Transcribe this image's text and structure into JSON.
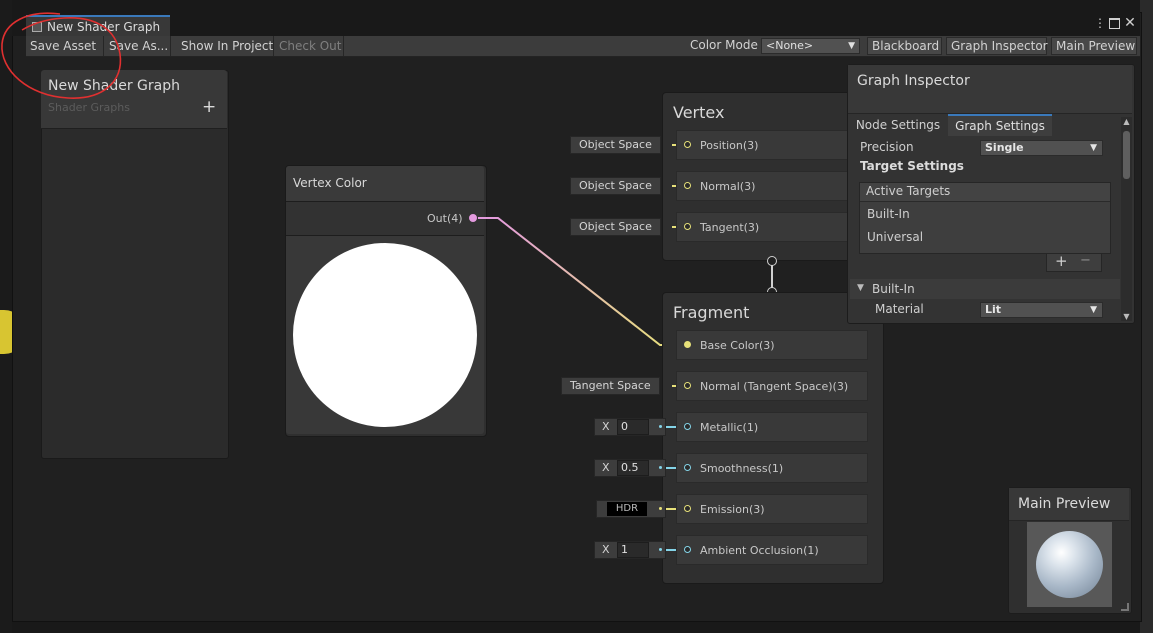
{
  "tab": {
    "title": "New Shader Graph"
  },
  "toolbar": {
    "save_asset": "Save Asset",
    "save_as": "Save As...",
    "show_in_project": "Show In Project",
    "check_out": "Check Out",
    "color_mode_label": "Color Mode",
    "color_mode_value": "<None>",
    "blackboard": "Blackboard",
    "graph_inspector": "Graph Inspector",
    "main_preview": "Main Preview"
  },
  "blackboard": {
    "title": "New Shader Graph",
    "subtitle": "Shader Graphs",
    "add": "+"
  },
  "vertex_color_node": {
    "title": "Vertex Color",
    "output": "Out(4)"
  },
  "vertex_block": {
    "title": "Vertex",
    "ports": [
      {
        "label": "Position(3)",
        "input": "Object Space"
      },
      {
        "label": "Normal(3)",
        "input": "Object Space"
      },
      {
        "label": "Tangent(3)",
        "input": "Object Space"
      }
    ]
  },
  "fragment_block": {
    "title": "Fragment",
    "ports": [
      {
        "label": "Base Color(3)",
        "input": ""
      },
      {
        "label": "Normal (Tangent Space)(3)",
        "input": "Tangent Space"
      },
      {
        "label": "Metallic(1)",
        "input_x": "X",
        "input_value": "0"
      },
      {
        "label": "Smoothness(1)",
        "input_x": "X",
        "input_value": "0.5"
      },
      {
        "label": "Emission(3)",
        "input": "HDR"
      },
      {
        "label": "Ambient Occlusion(1)",
        "input_x": "X",
        "input_value": "1"
      }
    ]
  },
  "inspector": {
    "title": "Graph Inspector",
    "tabs": [
      "Node Settings",
      "Graph Settings"
    ],
    "active_tab": "Graph Settings",
    "precision_label": "Precision",
    "precision_value": "Single",
    "target_settings": "Target Settings",
    "active_targets_header": "Active Targets",
    "targets": [
      "Built-In",
      "Universal"
    ],
    "add": "+",
    "remove": "−",
    "section_builtin": "Built-In",
    "material_label": "Material",
    "material_value": "Lit"
  },
  "main_preview": {
    "title": "Main Preview"
  },
  "left_edge": {
    "number": "5"
  },
  "colors": {
    "accent": "#3a79bb",
    "port_yellow": "#e7e17a",
    "port_blue": "#84d4e8",
    "annotation": "#e03030"
  }
}
